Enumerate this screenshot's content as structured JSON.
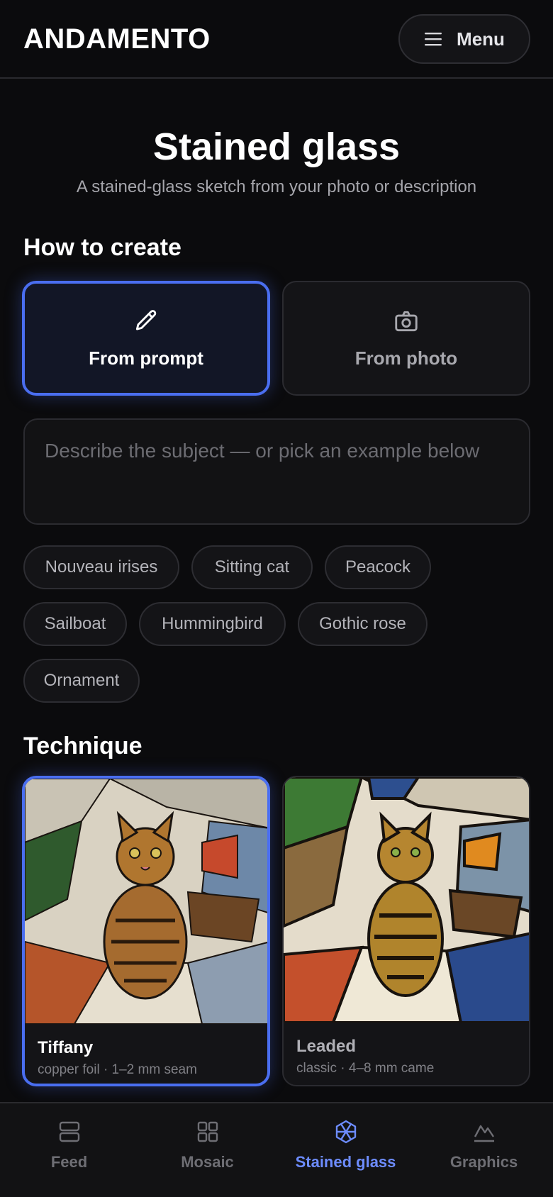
{
  "app": {
    "logo": "ANDAMENTO",
    "menu_label": "Menu"
  },
  "page": {
    "title": "Stained glass",
    "subtitle": "A stained-glass sketch from your photo or description"
  },
  "how_to_create": {
    "heading": "How to create",
    "modes": [
      {
        "label": "From prompt",
        "icon": "pencil-icon",
        "selected": true
      },
      {
        "label": "From photo",
        "icon": "camera-icon",
        "selected": false
      }
    ]
  },
  "prompt": {
    "placeholder": "Describe the subject — or pick an example below",
    "value": ""
  },
  "examples": [
    "Nouveau irises",
    "Sitting cat",
    "Peacock",
    "Sailboat",
    "Hummingbird",
    "Gothic rose",
    "Ornament"
  ],
  "technique": {
    "heading": "Technique",
    "options": [
      {
        "name": "Tiffany",
        "meta": "copper foil · 1–2 mm seam",
        "selected": true
      },
      {
        "name": "Leaded",
        "meta": "classic · 4–8 mm came",
        "selected": false
      }
    ]
  },
  "bottom_nav": [
    {
      "label": "Feed",
      "icon": "feed-icon",
      "active": false
    },
    {
      "label": "Mosaic",
      "icon": "grid-icon",
      "active": false
    },
    {
      "label": "Stained glass",
      "icon": "stained-glass-icon",
      "active": true
    },
    {
      "label": "Graphics",
      "icon": "mountain-icon",
      "active": false
    }
  ],
  "colors": {
    "accent": "#4a6ef0",
    "nav_active": "#6d8cff",
    "background": "#0b0b0d"
  }
}
